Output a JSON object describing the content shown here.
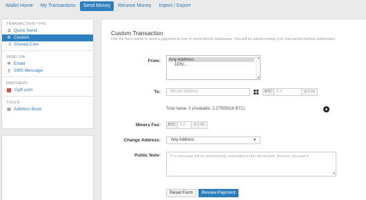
{
  "nav": {
    "tabs": [
      {
        "label": "Wallet Home"
      },
      {
        "label": "My Transactions"
      },
      {
        "label": "Send Money"
      },
      {
        "label": "Receive Money"
      },
      {
        "label": "Import / Export"
      }
    ],
    "active_tab": "Send Money"
  },
  "sidebar": {
    "sections": {
      "transaction_type": "TRANSACTION TYPE",
      "send_via": "SEND VIA",
      "partners": "PARTNERS",
      "tools": "TOOLS"
    },
    "items": {
      "quick_send": "Quick Send",
      "custom": "Custom",
      "shared_coin": "Shared Coin",
      "email": "Email",
      "sms": "SMS Message",
      "gyft": "Gyft.com",
      "address_book": "Address Book"
    },
    "icons": {
      "quick_send": "circle-arrow-icon",
      "custom": "gear-icon",
      "shared_coin": "shuffle-icon",
      "email": "envelope-icon",
      "sms": "phone-icon",
      "gyft": "gyft-logo-icon",
      "address_book": "book-icon"
    }
  },
  "main": {
    "title": "Custom Transaction",
    "description": "Use the form below to send a payment to one or more bitcoin addresses. You will be asked review your transaction before submission.",
    "from_label": "From:",
    "from_options": [
      "Any Address",
      "1CN..."
    ],
    "to_label": "To:",
    "to_placeholder": "Bitcoin Address",
    "btc_tag": "BTC",
    "amount_placeholder": "0.0",
    "usd_value": "$ 0.00",
    "total_value": "Total Value: 0 (Available: 2.27555016 BTC)",
    "fee_label": "Miners Fee:",
    "fee_placeholder": "0.0",
    "fee_usd": "$ 0.00",
    "change_label": "Change Address:",
    "change_value": "Any Address",
    "note_label": "Public Note:",
    "note_placeholder": "This message will be permanently embedded in the blockchain. Anyone can read it.",
    "reset_button": "Reset Form",
    "review_button": "Review Payment"
  },
  "colors": {
    "accent": "#2e7fbf",
    "link": "#2d77b5",
    "background": "#eaeaea"
  }
}
